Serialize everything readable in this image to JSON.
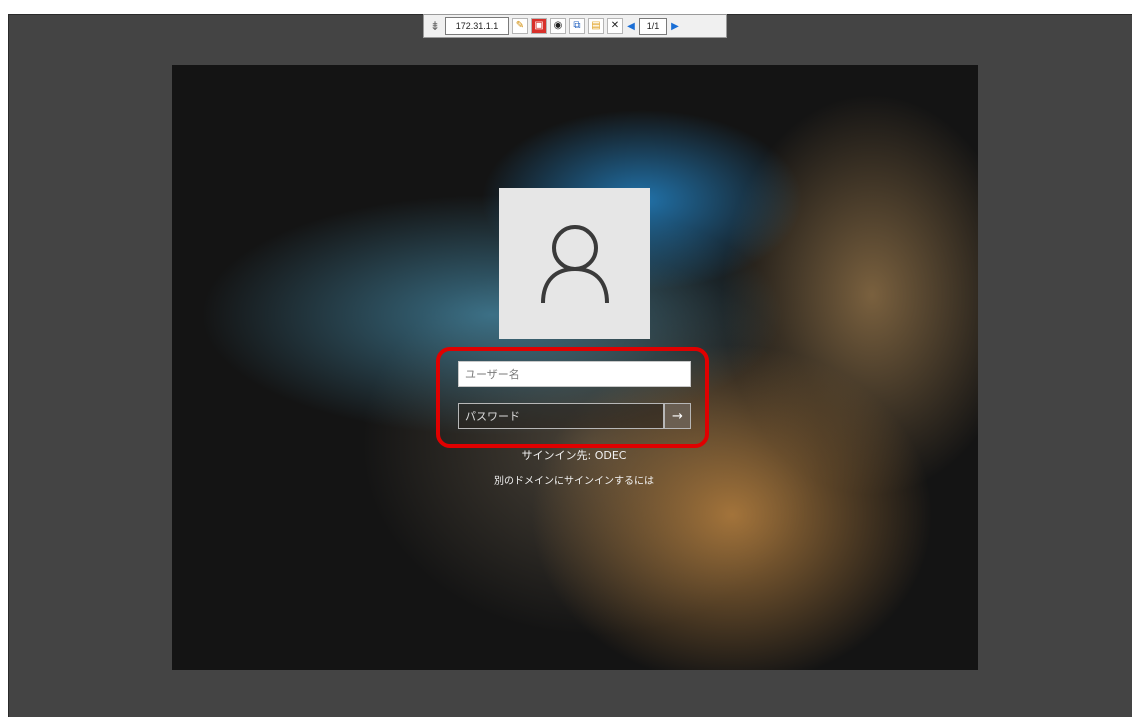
{
  "viewer": {
    "ip_address": "172.31.1.1",
    "page_indicator": "1/1",
    "icons": [
      "pin-icon",
      "pencil-icon",
      "monitor-icon",
      "camera-icon",
      "window-icon",
      "folder-icon",
      "close-icon",
      "prev-arrow-icon",
      "next-arrow-icon"
    ]
  },
  "login": {
    "username_placeholder": "ユーザー名",
    "password_placeholder": "パスワード",
    "submit_icon": "→",
    "sign_in_to": "サインイン先: ODEC",
    "other_domain_link": "別のドメインにサインインするには"
  },
  "bottom_icons": [
    "network-icon",
    "ease-of-access-icon",
    "power-icon"
  ],
  "colors": {
    "outer_background": "#444444",
    "highlight": "#e00000",
    "avatar_background": "#e6e6e6"
  }
}
